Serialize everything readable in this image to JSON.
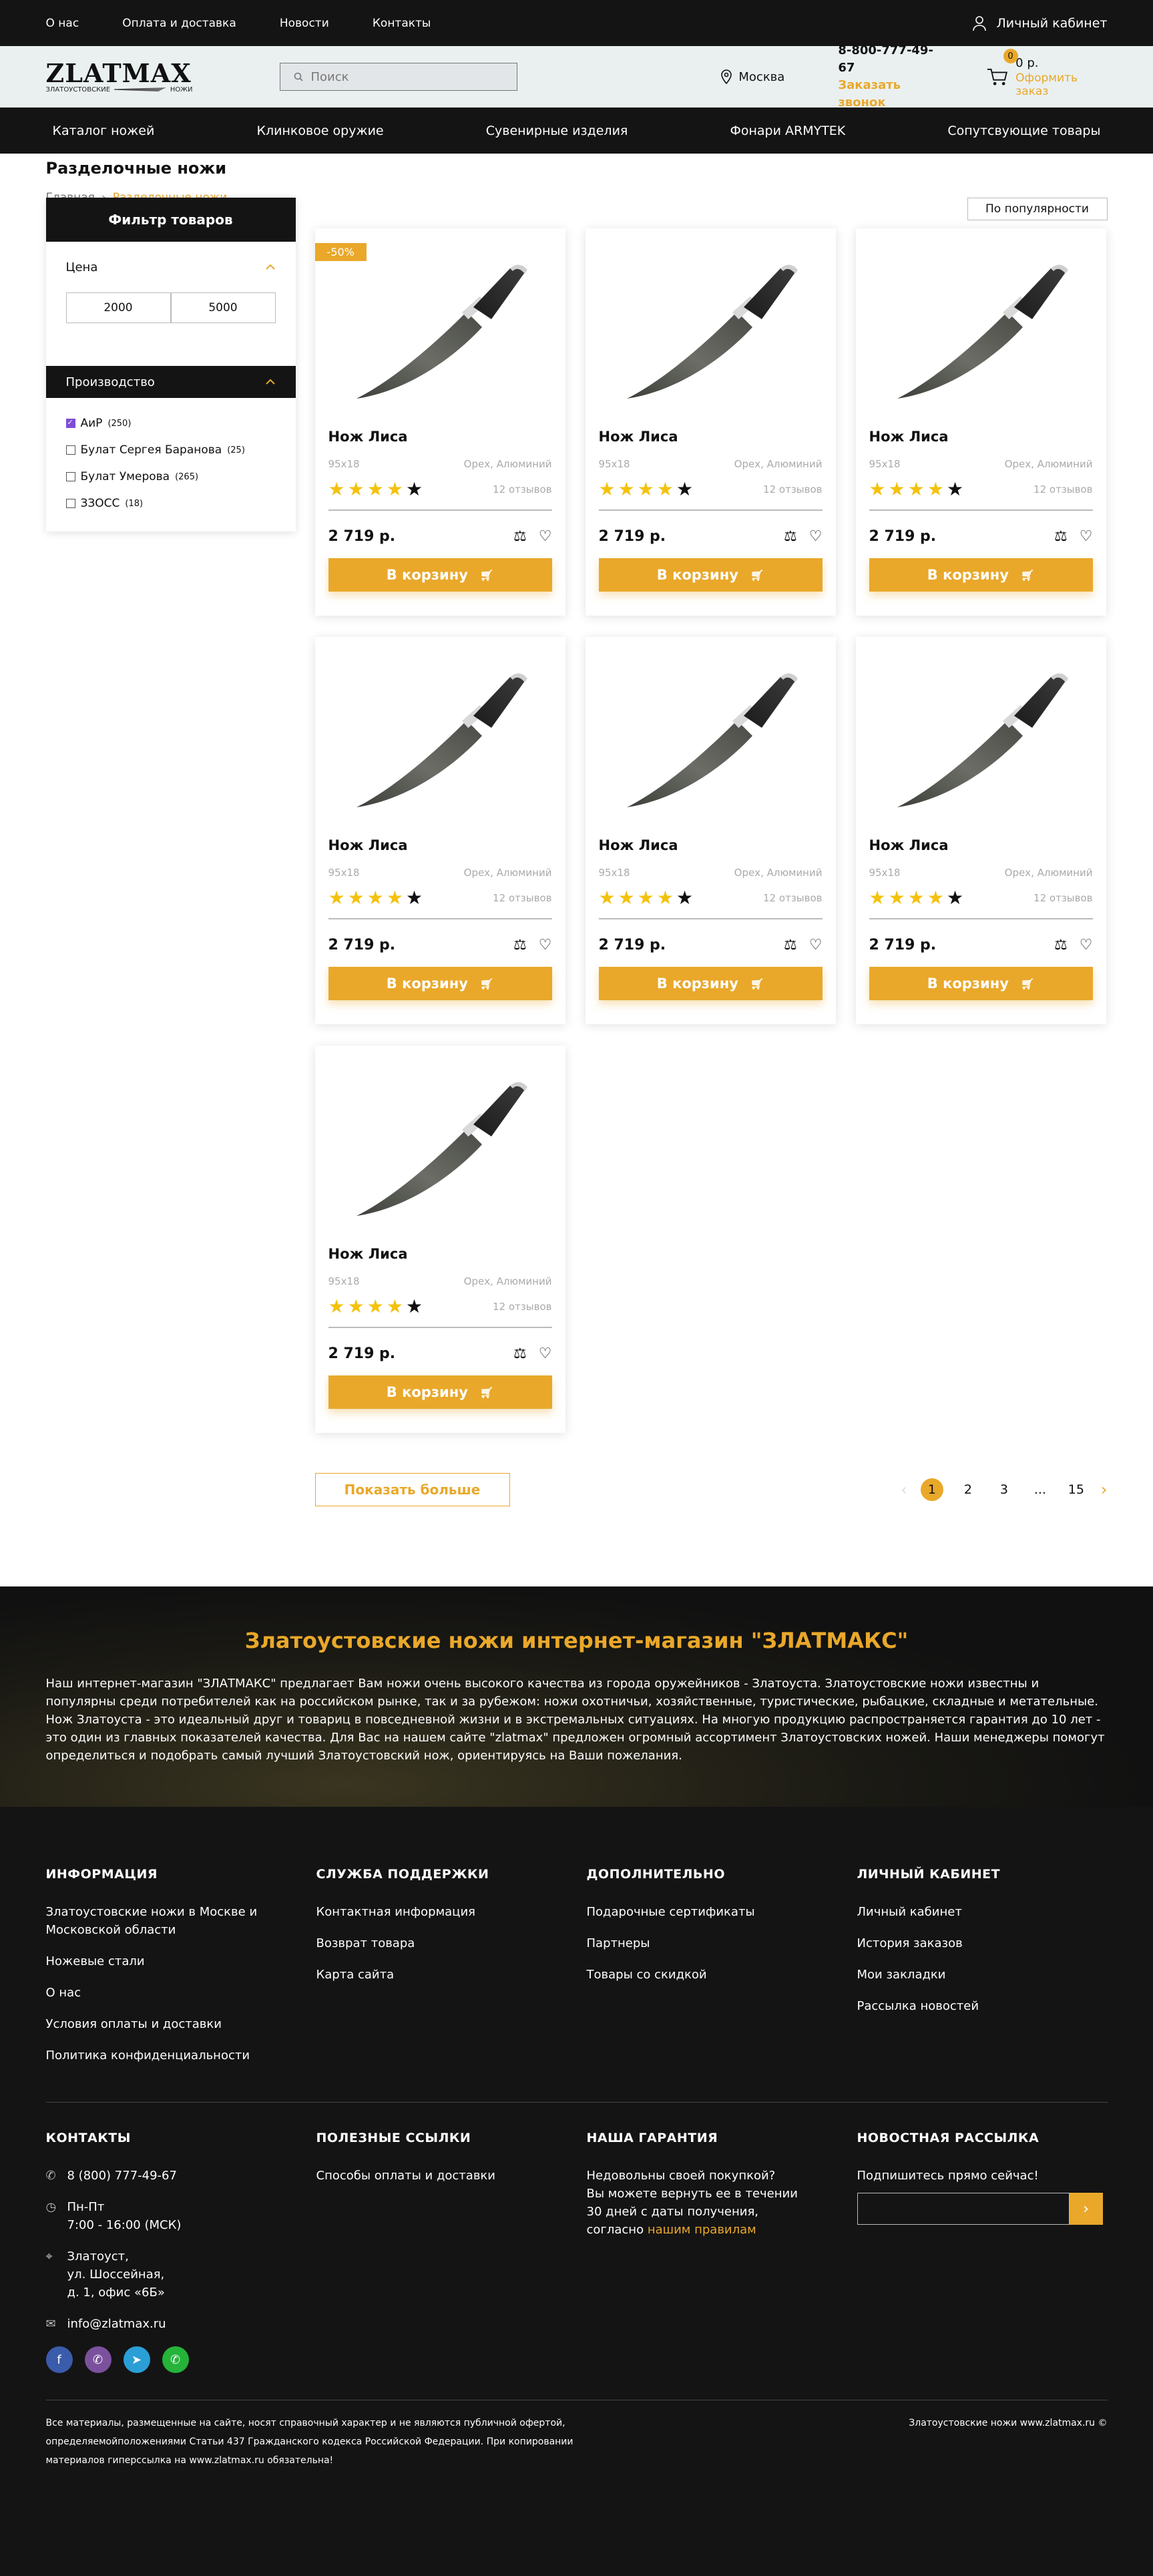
{
  "topbar": {
    "links": [
      "О нас",
      "Оплата и доставка",
      "Новости",
      "Контакты"
    ],
    "account": "Личный кабинет"
  },
  "header": {
    "logo_name": "ZLATMAX",
    "logo_left": "ЗЛАТОУСТОВСКИЕ",
    "logo_right": "НОЖИ",
    "search_placeholder": "Поиск",
    "city": "Москва",
    "phone": "8-800-777-49-67",
    "call_link": "Заказать звонок",
    "cart_count": "0",
    "cart_sum": "0 р.",
    "checkout": "Оформить заказ"
  },
  "nav": [
    "Каталог ножей",
    "Клинковое оружие",
    "Сувенирные изделия",
    "Фонари ARMYTEK",
    "Сопутсвующие товары"
  ],
  "page": {
    "title": "Разделочные ножи",
    "crumb_home": "Главная",
    "crumb_sep": "›",
    "crumb_current": "Разделочные ножи"
  },
  "filter": {
    "title": "Фильтр товаров",
    "price_label": "Цена",
    "price_from": "2000",
    "price_to": "5000",
    "maker_label": "Производство",
    "makers": [
      {
        "name": "АиР",
        "count": "(250)",
        "checked": true
      },
      {
        "name": "Булат Сергея Баранова",
        "count": "(25)",
        "checked": false
      },
      {
        "name": "Булат Умерова",
        "count": "(265)",
        "checked": false
      },
      {
        "name": "ЗЗОСС",
        "count": "(18)",
        "checked": false
      }
    ]
  },
  "sort": "По популярности",
  "products": [
    {
      "sale": "-50%",
      "title": "Нож Лиса",
      "size": "95х18",
      "handle": "Орех, Алюминий",
      "reviews": "12 отзывов",
      "price": "2 719 р.",
      "rating": 4.5
    },
    {
      "sale": "",
      "title": "Нож Лиса",
      "size": "95х18",
      "handle": "Орех, Алюминий",
      "reviews": "12 отзывов",
      "price": "2 719 р.",
      "rating": 4.5
    },
    {
      "sale": "",
      "title": "Нож Лиса",
      "size": "95х18",
      "handle": "Орех, Алюминий",
      "reviews": "12 отзывов",
      "price": "2 719 р.",
      "rating": 4.5
    },
    {
      "sale": "",
      "title": "Нож Лиса",
      "size": "95х18",
      "handle": "Орех, Алюминий",
      "reviews": "12 отзывов",
      "price": "2 719 р.",
      "rating": 4.5
    },
    {
      "sale": "",
      "title": "Нож Лиса",
      "size": "95х18",
      "handle": "Орех, Алюминий",
      "reviews": "12 отзывов",
      "price": "2 719 р.",
      "rating": 4.5
    },
    {
      "sale": "",
      "title": "Нож Лиса",
      "size": "95х18",
      "handle": "Орех, Алюминий",
      "reviews": "12 отзывов",
      "price": "2 719 р.",
      "rating": 4.5
    },
    {
      "sale": "",
      "title": "Нож Лиса",
      "size": "95х18",
      "handle": "Орех, Алюминий",
      "reviews": "12 отзывов",
      "price": "2 719 р.",
      "rating": 4.5
    }
  ],
  "buy_label": "В корзину",
  "show_more": "Показать больше",
  "pagination": {
    "pages": [
      "1",
      "2",
      "3",
      "...",
      "15"
    ],
    "current": "1"
  },
  "about": {
    "title": "Златоустовские ножи интернет-магазин \"ЗЛАТМАКС\"",
    "text": "Наш интернет-магазин \"ЗЛАТМАКС\" предлагает Вам ножи очень высокого качества из города оружейников - Златоуста. Златоустовские ножи известны и популярны среди потребителей как на российском рынке, так и за рубежом: ножи охотничьи, хозяйственные, туристические, рыбацкие, складные и метательные. Нож Златоуста - это идеальный друг и товариц в повседневной жизни и в экстремальных ситуациях. На многую продукцию распространяется гарантия до 10 лет - это один из главных показателей качества. Для Вас на нашем сайте \"zlatmax\" предложен огромный ассортимент Златоустовских ножей. Наши менеджеры помогут определиться и подобрать самый лучший Златоустовский нож, ориентируясь на Ваши пожелания."
  },
  "footer": {
    "columns": [
      {
        "title": "ИНФОРМАЦИЯ",
        "items": [
          "Златоустовские ножи в Москве и Московской области",
          "Ножевые стали",
          "О нас",
          "Условия оплаты и доставки",
          "Политика конфиденциальности"
        ]
      },
      {
        "title": "СЛУЖБА ПОДДЕРЖКИ",
        "items": [
          "Контактная информация",
          "Возврат товара",
          "Карта сайта"
        ]
      },
      {
        "title": "ДОПОЛНИТЕЛЬНО",
        "items": [
          "Подарочные сертификаты",
          "Партнеры",
          "Товары со скидкой"
        ]
      },
      {
        "title": "ЛИЧНЫЙ КАБИНЕТ",
        "items": [
          "Личный кабинет",
          "История заказов",
          "Мои закладки",
          "Рассылка новостей"
        ]
      }
    ],
    "contacts_title": "КОНТАКТЫ",
    "phone": "8 (800) 777-49-67",
    "hours_days": "Пн-Пт",
    "hours_time": "7:00 - 16:00 (МСК)",
    "addr1": "Златоуст,",
    "addr2": "ул. Шоссейная,",
    "addr3": "д. 1, офис «6Б»",
    "email": "info@zlatmax.ru",
    "links_title": "ПОЛЕЗНЫЕ ССЫЛКИ",
    "links": [
      "Способы оплаты и доставки"
    ],
    "guarantee_title": "НАША ГАРАНТИЯ",
    "guarantee_l1": "Недовольны своей покупкой?",
    "guarantee_l2": "Вы можете вернуть ее в течении",
    "guarantee_l3": "30 дней с даты получения,",
    "guarantee_l4": "согласно",
    "guarantee_link": "нашим правилам",
    "news_title": "НОВОСТНАЯ РАССЫЛКА",
    "news_sub": "Подпишитесь прямо сейчас!",
    "legal": "Все материалы, размещенные на сайте, носят справочный характер и не являются публичной офертой, определяемойположениями Статьи 437 Гражданского кодекса Российской Федерации. При копировании материалов гиперссылка на www.zlatmax.ru обязательна!",
    "copyright": "Златоустовские ножи www.zlatmax.ru ©"
  },
  "colors": {
    "accent": "#e9a82a",
    "dark": "#141414",
    "header_bg": "#eaf0f0",
    "checkbox": "#7d4dd6"
  }
}
